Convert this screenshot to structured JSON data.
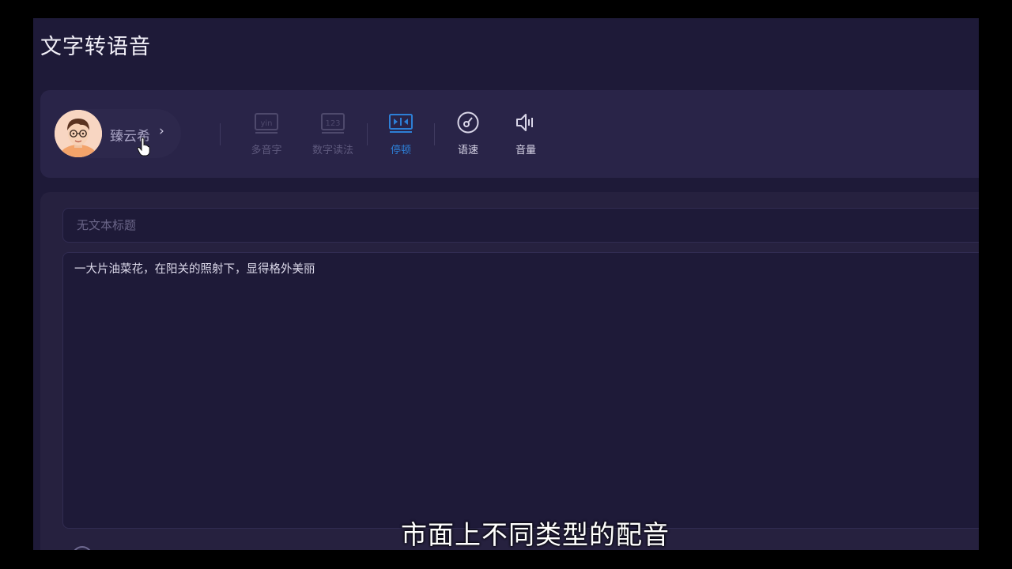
{
  "app": {
    "page_title": "文字转语音"
  },
  "voice": {
    "name": "臻云希",
    "chevron": "›"
  },
  "toolbar": {
    "items": [
      {
        "label": "多音字",
        "icon": "yin-box-icon",
        "state": "disabled"
      },
      {
        "label": "数字读法",
        "icon": "number-123-icon",
        "state": "disabled"
      },
      {
        "label": "停顿",
        "icon": "pause-insert-icon",
        "state": "active"
      },
      {
        "label": "语速",
        "icon": "speed-gauge-icon",
        "state": "normal"
      },
      {
        "label": "音量",
        "icon": "speaker-volume-icon",
        "state": "normal"
      }
    ],
    "icon_text_yin": "yin",
    "icon_text_123": "123"
  },
  "editor": {
    "title_placeholder": "无文本标题",
    "title_value": "",
    "body_text": "一大片油菜花，在阳关的照射下，显得格外美丽"
  },
  "video": {
    "subtitle": "市面上不同类型的配音"
  },
  "colors": {
    "background": "#1e1a38",
    "card": "#292448",
    "active_accent": "#2d7fd6",
    "disabled_text": "#5f5a7e"
  }
}
